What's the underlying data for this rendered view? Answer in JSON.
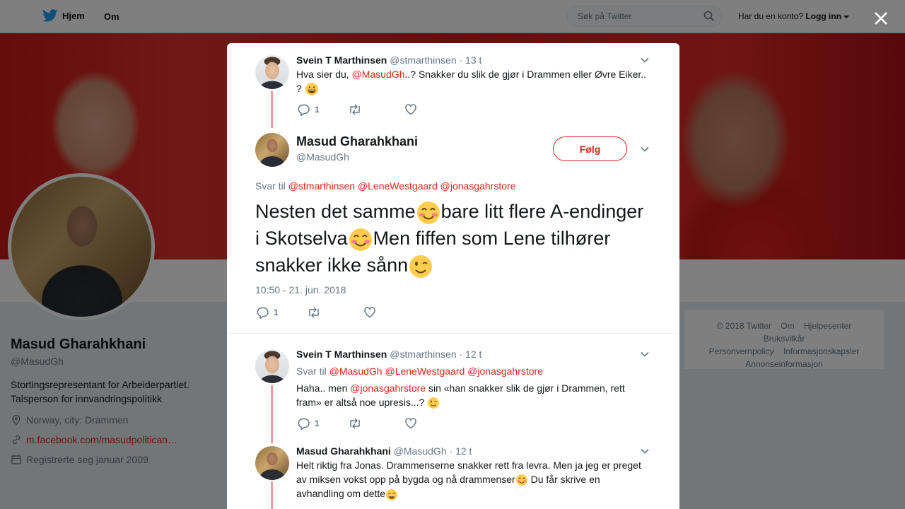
{
  "nav": {
    "home": "Hjem",
    "about": "Om",
    "search_placeholder": "Søk på Twitter",
    "account_question": "Har du en konto?",
    "login": "Logg inn"
  },
  "profile": {
    "name": "Masud Gharahkhani",
    "handle": "@MasudGh",
    "bio": "Stortingsrepresentant for Arbeiderpartiet. Talsperson for innvandringspolitikk",
    "location": "Norway, city: Drammen",
    "link": "m.facebook.com/masudpolitican…",
    "joined": "Registrerte seg januar 2009"
  },
  "footer": {
    "links": [
      "© 2018 Twitter",
      "Om",
      "Hjelpesenter",
      "Bruksvilkår",
      "Personvernpolicy",
      "Informasjonskapsler",
      "Annonseinformasjon"
    ]
  },
  "modal": {
    "parent": {
      "name": "Svein T Marthinsen",
      "handle": "@stmarthinsen",
      "time": "· 13 t",
      "text_before": "Hva sier du, ",
      "mention": "@MasudGh",
      "text_after": "..? Snakker du slik de gjør i Drammen eller Øvre Eiker.. ?",
      "reply_count": "1"
    },
    "main": {
      "name": "Masud Gharahkhani",
      "handle": "@MasudGh",
      "follow": "Følg",
      "reply_label": "Svar til",
      "reply_mentions": "@stmarthinsen @LeneWestgaard @jonasgahrstore",
      "text_1": "Nesten det samme",
      "text_2": "bare litt flere A-endinger i Skotselva",
      "text_3": "Men fiffen som Lene tilhører snakker ikke sånn",
      "date": "10:50 - 21. jun. 2018",
      "reply_count": "1"
    },
    "reply1": {
      "name": "Svein T Marthinsen",
      "handle": "@stmarthinsen",
      "time": "· 12 t",
      "reply_label": "Svar til",
      "reply_mentions": "@MasudGh @LeneWestgaard @jonasgahrstore",
      "text_before": "Haha.. men ",
      "mention": "@jonasgahrstore",
      "text_after": " sin «han snakker slik de gjør i Drammen, rett fram» er altså noe upresis...?",
      "reply_count": "1"
    },
    "reply2": {
      "name": "Masud Gharahkhani",
      "handle": "@MasudGh",
      "time": "· 12 t",
      "text_1": "Helt riktig fra Jonas. Drammenserne snakker rett fra levra. Men ja jeg er preget av miksen vokst opp på bygda og nå drammenser",
      "text_2": " Du får skrive en avhandling om dette"
    }
  },
  "colors": {
    "accent": "#e0251b",
    "thread_line": "#f19a9a",
    "muted": "#657786"
  }
}
